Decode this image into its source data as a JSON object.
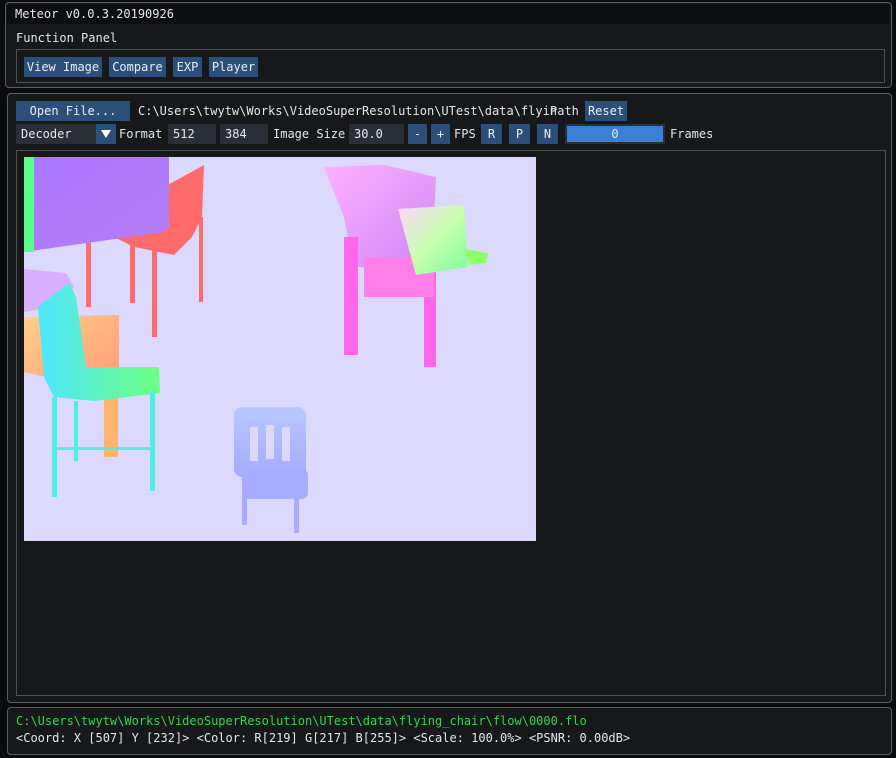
{
  "window": {
    "title": "Meteor v0.0.3.20190926"
  },
  "function_panel": {
    "title": "Function Panel",
    "buttons": [
      "View Image",
      "Compare",
      "EXP",
      "Player"
    ]
  },
  "player": {
    "open_file_label": "Open File...",
    "path_value": "C:\\Users\\twytw\\Works\\VideoSuperResolution\\UTest\\data\\flyin",
    "path_label": "Path",
    "reset_label": "Reset",
    "decoder_value": "Decoder",
    "format_label": "Format",
    "width_value": "512",
    "height_value": "384",
    "image_size_label": "Image Size",
    "fps_value": "30.0",
    "minus_label": "-",
    "plus_label": "+",
    "fps_label": "FPS",
    "r_label": "R",
    "p_label": "P",
    "n_label": "N",
    "frames_value": "0",
    "frames_label": "Frames"
  },
  "status": {
    "file_path": "C:\\Users\\twytw\\Works\\VideoSuperResolution\\UTest\\data\\flying_chair\\flow\\0000.flo",
    "info": "<Coord: X [507]  Y [232]> <Color: R[219] G[217] B[255]> <Scale: 100.0%> <PSNR: 0.00dB>"
  },
  "colors": {
    "button": "#2c4f7a",
    "progress": "#3a7fd6",
    "status_path": "#37d64a",
    "image_background": "#dcd9ff"
  }
}
